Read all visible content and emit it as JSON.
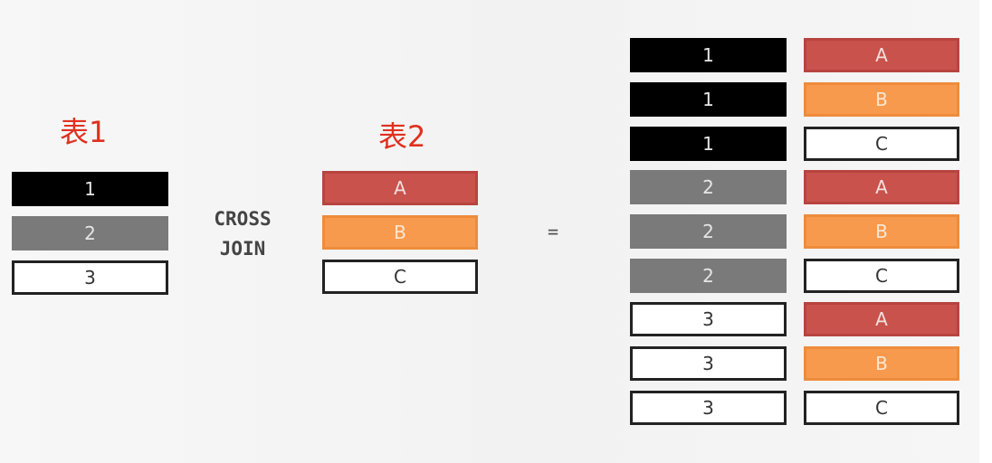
{
  "table1": {
    "title": "表1",
    "rows": [
      {
        "value": "1",
        "color": "#000000"
      },
      {
        "value": "2",
        "color": "#7a7a7a"
      },
      {
        "value": "3",
        "color": "#ffffff"
      }
    ]
  },
  "operator": {
    "line1": "CROSS",
    "line2": "JOIN"
  },
  "table2": {
    "title": "表2",
    "rows": [
      {
        "value": "A",
        "color": "#c9524d"
      },
      {
        "value": "B",
        "color": "#f79a4d"
      },
      {
        "value": "C",
        "color": "#ffffff"
      }
    ]
  },
  "equals": "=",
  "result": {
    "rows": [
      {
        "left": "1",
        "right": "A"
      },
      {
        "left": "1",
        "right": "B"
      },
      {
        "left": "1",
        "right": "C"
      },
      {
        "left": "2",
        "right": "A"
      },
      {
        "left": "2",
        "right": "B"
      },
      {
        "left": "2",
        "right": "C"
      },
      {
        "left": "3",
        "right": "A"
      },
      {
        "left": "3",
        "right": "B"
      },
      {
        "left": "3",
        "right": "C"
      }
    ]
  }
}
